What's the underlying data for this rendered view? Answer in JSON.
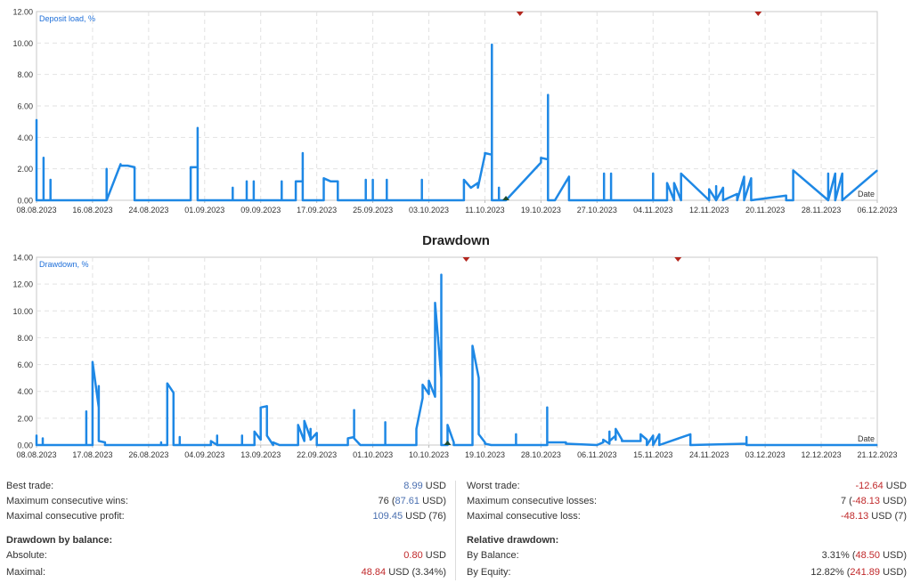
{
  "drawdown_title": "Drawdown",
  "chart_data": [
    {
      "type": "line",
      "title": "",
      "series_label": "Deposit load, %",
      "xlabel": "Date",
      "ylim": [
        0,
        12
      ],
      "yticks": [
        "0.00",
        "2.00",
        "4.00",
        "6.00",
        "8.00",
        "10.00",
        "12.00"
      ],
      "xlim": [
        "2023-08-08",
        "2023-12-06"
      ],
      "xticks": [
        "08.08.2023",
        "16.08.2023",
        "24.08.2023",
        "01.09.2023",
        "09.09.2023",
        "17.09.2023",
        "25.09.2023",
        "03.10.2023",
        "11.10.2023",
        "19.10.2023",
        "27.10.2023",
        "04.11.2023",
        "12.11.2023",
        "20.11.2023",
        "28.11.2023",
        "06.12.2023"
      ],
      "grid": true,
      "color": "#1e88e5",
      "top_markers": [
        "2023-10-16",
        "2023-11-19"
      ],
      "bottom_markers": [
        "2023-10-14"
      ],
      "x": [
        "2023-08-08",
        "2023-08-08",
        "2023-08-08",
        "2023-08-09",
        "2023-08-09",
        "2023-08-09",
        "2023-08-10",
        "2023-08-10",
        "2023-08-10",
        "2023-08-10",
        "2023-08-18",
        "2023-08-18",
        "2023-08-18",
        "2023-08-18",
        "2023-08-20",
        "2023-08-20",
        "2023-08-21",
        "2023-08-22",
        "2023-08-22",
        "2023-08-22",
        "2023-08-30",
        "2023-08-30",
        "2023-08-31",
        "2023-08-31",
        "2023-08-31",
        "2023-08-31",
        "2023-08-31",
        "2023-09-05",
        "2023-09-05",
        "2023-09-05",
        "2023-09-05",
        "2023-09-07",
        "2023-09-07",
        "2023-09-07",
        "2023-09-08",
        "2023-09-08",
        "2023-09-08",
        "2023-09-12",
        "2023-09-12",
        "2023-09-12",
        "2023-09-14",
        "2023-09-14",
        "2023-09-15",
        "2023-09-15",
        "2023-09-15",
        "2023-09-15",
        "2023-09-18",
        "2023-09-18",
        "2023-09-19",
        "2023-09-20",
        "2023-09-20",
        "2023-09-20",
        "2023-09-24",
        "2023-09-24",
        "2023-09-24",
        "2023-09-25",
        "2023-09-25",
        "2023-09-25",
        "2023-09-27",
        "2023-09-27",
        "2023-09-27",
        "2023-10-02",
        "2023-10-02",
        "2023-10-02",
        "2023-10-08",
        "2023-10-08",
        "2023-10-09",
        "2023-10-10",
        "2023-10-10",
        "2023-10-11",
        "2023-10-11",
        "2023-10-12",
        "2023-10-12",
        "2023-10-12",
        "2023-10-13",
        "2023-10-13",
        "2023-10-13",
        "2023-10-13",
        "2023-10-14",
        "2023-10-14",
        "2023-10-19",
        "2023-10-19",
        "2023-10-20",
        "2023-10-20",
        "2023-10-20",
        "2023-10-21",
        "2023-10-21",
        "2023-10-23",
        "2023-10-23",
        "2023-10-28",
        "2023-10-28",
        "2023-10-28",
        "2023-10-29",
        "2023-10-29",
        "2023-10-29",
        "2023-11-04",
        "2023-11-04",
        "2023-11-04",
        "2023-11-06",
        "2023-11-06",
        "2023-11-07",
        "2023-11-07",
        "2023-11-08",
        "2023-11-08",
        "2023-11-08",
        "2023-11-12",
        "2023-11-12",
        "2023-11-12",
        "2023-11-13",
        "2023-11-13",
        "2023-11-13",
        "2023-11-13",
        "2023-11-14",
        "2023-11-14",
        "2023-11-14",
        "2023-11-16",
        "2023-11-16",
        "2023-11-16",
        "2023-11-17",
        "2023-11-17",
        "2023-11-17",
        "2023-11-18",
        "2023-11-18",
        "2023-11-18",
        "2023-11-23",
        "2023-11-23",
        "2023-11-24",
        "2023-11-24",
        "2023-11-29",
        "2023-11-29",
        "2023-11-29",
        "2023-11-30",
        "2023-11-30",
        "2023-11-30",
        "2023-12-01",
        "2023-12-01",
        "2023-12-01",
        "2023-12-06"
      ],
      "values": [
        0,
        5.1,
        0,
        0,
        2.7,
        0,
        0,
        1.3,
        0,
        0,
        0,
        2.0,
        0,
        0,
        2.3,
        2.2,
        2.2,
        2.1,
        0,
        0,
        0,
        2.1,
        2.1,
        4.6,
        2.2,
        0,
        0,
        0,
        0.8,
        0,
        0,
        0,
        1.2,
        0,
        0,
        1.2,
        0,
        0,
        1.2,
        0,
        0,
        1.2,
        1.2,
        3.0,
        1.2,
        0,
        0,
        1.4,
        1.2,
        1.2,
        0.1,
        0,
        0,
        1.3,
        0,
        0,
        1.3,
        0,
        0,
        1.3,
        0,
        0,
        1.3,
        0,
        0,
        1.3,
        0.8,
        1.1,
        0.8,
        2.9,
        3.0,
        2.9,
        9.9,
        0,
        0,
        0.8,
        0.8,
        0,
        0,
        0,
        2.4,
        2.7,
        2.6,
        6.7,
        0,
        0,
        0,
        1.5,
        0,
        0,
        1.7,
        0,
        0,
        1.7,
        0,
        0,
        1.7,
        0,
        0,
        1.1,
        0,
        1.1,
        0,
        0,
        1.7,
        0,
        0,
        0.7,
        0,
        0.9,
        0.5,
        0,
        0.8,
        0.2,
        0,
        0.4,
        0,
        0,
        1.5,
        0,
        0,
        1.4,
        0,
        0,
        0.3,
        0,
        0,
        1.9,
        0,
        1.7,
        0,
        1.7,
        0,
        0,
        1.7,
        0,
        0,
        1.9,
        0,
        0
      ]
    },
    {
      "type": "line",
      "title": "Drawdown",
      "series_label": "Drawdown, %",
      "xlabel": "Date",
      "ylim": [
        0,
        14
      ],
      "yticks": [
        "0.00",
        "2.00",
        "4.00",
        "6.00",
        "8.00",
        "10.00",
        "12.00",
        "14.00"
      ],
      "xlim": [
        "2023-08-08",
        "2023-12-21"
      ],
      "xticks": [
        "08.08.2023",
        "17.08.2023",
        "26.08.2023",
        "04.09.2023",
        "13.09.2023",
        "22.09.2023",
        "01.10.2023",
        "10.10.2023",
        "19.10.2023",
        "28.10.2023",
        "06.11.2023",
        "15.11.2023",
        "24.11.2023",
        "03.12.2023",
        "12.12.2023",
        "21.12.2023"
      ],
      "grid": true,
      "color": "#1e88e5",
      "top_markers": [
        "2023-10-16",
        "2023-11-19"
      ],
      "bottom_markers": [
        "2023-10-13"
      ],
      "x": [
        "2023-08-08",
        "2023-08-08",
        "2023-08-08",
        "2023-08-09",
        "2023-08-09",
        "2023-08-09",
        "2023-08-15",
        "2023-08-16",
        "2023-08-16",
        "2023-08-16",
        "2023-08-17",
        "2023-08-17",
        "2023-08-18",
        "2023-08-18",
        "2023-08-18",
        "2023-08-18",
        "2023-08-19",
        "2023-08-19",
        "2023-08-19",
        "2023-08-20",
        "2023-08-28",
        "2023-08-28",
        "2023-08-28",
        "2023-08-29",
        "2023-08-29",
        "2023-08-29",
        "2023-08-30",
        "2023-08-30",
        "2023-08-30",
        "2023-08-31",
        "2023-08-31",
        "2023-08-31",
        "2023-09-05",
        "2023-09-05",
        "2023-09-06",
        "2023-09-06",
        "2023-09-06",
        "2023-09-10",
        "2023-09-10",
        "2023-09-10",
        "2023-09-12",
        "2023-09-12",
        "2023-09-13",
        "2023-09-13",
        "2023-09-14",
        "2023-09-14",
        "2023-09-14",
        "2023-09-15",
        "2023-09-15",
        "2023-09-16",
        "2023-09-16",
        "2023-09-19",
        "2023-09-19",
        "2023-09-20",
        "2023-09-20",
        "2023-09-21",
        "2023-09-21",
        "2023-09-21",
        "2023-09-22",
        "2023-09-22",
        "2023-09-22",
        "2023-09-27",
        "2023-09-27",
        "2023-09-28",
        "2023-09-28",
        "2023-09-28",
        "2023-09-28",
        "2023-09-29",
        "2023-10-03",
        "2023-10-03",
        "2023-10-03",
        "2023-10-08",
        "2023-10-08",
        "2023-10-09",
        "2023-10-09",
        "2023-10-10",
        "2023-10-10",
        "2023-10-11",
        "2023-10-11",
        "2023-10-12",
        "2023-10-12",
        "2023-10-12",
        "2023-10-12",
        "2023-10-13",
        "2023-10-13",
        "2023-10-13",
        "2023-10-14",
        "2023-10-14",
        "2023-10-14",
        "2023-10-14",
        "2023-10-17",
        "2023-10-17",
        "2023-10-17",
        "2023-10-18",
        "2023-10-18",
        "2023-10-18",
        "2023-10-19",
        "2023-10-19",
        "2023-10-20",
        "2023-10-24",
        "2023-10-24",
        "2023-10-24",
        "2023-10-29",
        "2023-10-29",
        "2023-10-29",
        "2023-11-01",
        "2023-11-01",
        "2023-11-06",
        "2023-11-07",
        "2023-11-07",
        "2023-11-08",
        "2023-11-08",
        "2023-11-08",
        "2023-11-09",
        "2023-11-09",
        "2023-11-09",
        "2023-11-10",
        "2023-11-10",
        "2023-11-13",
        "2023-11-13",
        "2023-11-14",
        "2023-11-14",
        "2023-11-15",
        "2023-11-15",
        "2023-11-15",
        "2023-11-16",
        "2023-11-16",
        "2023-11-16",
        "2023-11-21",
        "2023-11-21",
        "2023-11-21",
        "2023-11-30",
        "2023-11-30",
        "2023-11-30",
        "2023-12-21"
      ],
      "values": [
        0,
        0.7,
        0,
        0,
        0.5,
        0,
        0,
        0,
        2.5,
        0,
        0,
        6.2,
        2.8,
        4.4,
        2.5,
        0.3,
        0.2,
        0,
        0,
        0,
        0,
        0.2,
        0,
        0,
        2.0,
        4.6,
        3.9,
        2.5,
        0,
        0,
        0.6,
        0,
        0,
        0.3,
        0,
        0.7,
        0,
        0,
        0.7,
        0,
        0,
        1.0,
        0.4,
        2.8,
        2.9,
        2.3,
        0.7,
        0,
        0.2,
        0,
        0,
        0,
        1.5,
        0.3,
        1.8,
        0.5,
        1.2,
        0.4,
        0.9,
        0.3,
        0,
        0,
        0.5,
        0.6,
        2.4,
        2.6,
        0.5,
        0,
        0,
        1.7,
        0,
        0,
        1.2,
        3.5,
        4.5,
        3.8,
        4.8,
        3.6,
        10.6,
        5.0,
        8.7,
        12.7,
        0,
        0,
        0.3,
        1.5,
        0.2,
        0,
        0,
        0,
        0,
        7.1,
        7.4,
        5.0,
        1.5,
        0.8,
        0.2,
        0.1,
        0,
        0,
        0.8,
        0,
        0,
        2.8,
        0.2,
        0.2,
        0.1,
        0,
        0.2,
        0.4,
        0.1,
        1.0,
        0.3,
        0.7,
        0.4,
        1.2,
        0.4,
        0.3,
        0.3,
        0.8,
        0.4,
        0,
        0.7,
        0.3,
        0,
        0.8,
        0,
        0,
        0.8,
        0,
        0,
        0.1,
        0.6,
        0,
        0
      ]
    }
  ],
  "stats": {
    "left": [
      {
        "label": "Best trade:",
        "value": "8.99",
        "suffix": " USD",
        "value_color": "blue"
      },
      {
        "label": "Maximum consecutive wins:",
        "value": "76 (",
        "value2": "87.61",
        "suffix": " USD)",
        "value_color": "blue2"
      },
      {
        "label": "Maximal consecutive profit:",
        "value": "109.45",
        "suffix": " USD (76)",
        "value_color": "blue"
      }
    ],
    "left_heading": "Drawdown by balance:",
    "left_dd": [
      {
        "label": "Absolute:",
        "value": "0.80",
        "suffix": " USD",
        "value_color": "red"
      },
      {
        "label": "Maximal:",
        "value": "48.84",
        "suffix": " USD (3.34%)",
        "value_color": "red"
      }
    ],
    "right": [
      {
        "label": "Worst trade:",
        "value": "-12.64",
        "suffix": " USD",
        "value_color": "red"
      },
      {
        "label": "Maximum consecutive losses:",
        "value": "7 (",
        "value2": "-48.13",
        "suffix": " USD)",
        "value_color": "red2"
      },
      {
        "label": "Maximal consecutive loss:",
        "value": "-48.13",
        "suffix": " USD (7)",
        "value_color": "red"
      }
    ],
    "right_heading": "Relative drawdown:",
    "right_dd": [
      {
        "label": "By Balance:",
        "value": "3.31% (",
        "value2": "48.50",
        "suffix": " USD)",
        "value_color": "red2"
      },
      {
        "label": "By Equity:",
        "value": "12.82% (",
        "value2": "241.89",
        "suffix": " USD)",
        "value_color": "red2"
      }
    ]
  }
}
